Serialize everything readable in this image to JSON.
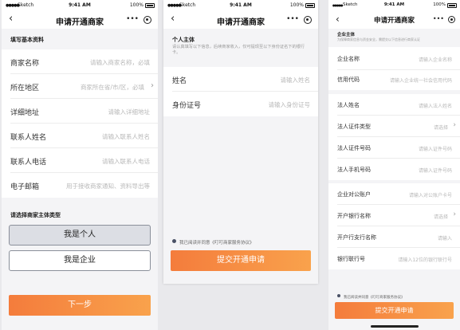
{
  "status": {
    "carrier": "Sketch",
    "time": "9:41 AM",
    "battery": "100%"
  },
  "nav": {
    "title": "申请开通商家",
    "more": "•••"
  },
  "screen1": {
    "section_title": "填写基本资料",
    "fields": [
      {
        "label": "商家名称",
        "placeholder": "请输入商家名称，必填"
      },
      {
        "label": "所在地区",
        "placeholder": "商家所在省/市/区，必填"
      },
      {
        "label": "详细地址",
        "placeholder": "请输入详细地址"
      },
      {
        "label": "联系人姓名",
        "placeholder": "请输入联系人姓名"
      },
      {
        "label": "联系人电话",
        "placeholder": "请输入联系人电话"
      },
      {
        "label": "电子邮箱",
        "placeholder": "用于接收商家通知、资料导出等"
      }
    ],
    "type_title": "请选择商家主体类型",
    "type_personal": "我是个人",
    "type_company": "我是企业",
    "next": "下一步"
  },
  "screen2": {
    "section_title": "个人主体",
    "section_desc": "请认真填写以下信息，后续商家收入，仅可提现至以下身份证名下的银行卡。",
    "fields": [
      {
        "label": "姓名",
        "placeholder": "请输入姓名"
      },
      {
        "label": "身份证号",
        "placeholder": "请输入身份证号"
      }
    ],
    "agree": "我已阅读并同意《叮叮商家服务协议》",
    "submit": "提交开通申请"
  },
  "screen3": {
    "section_title": "企业主体",
    "section_desc": "为保障商家信息与资金安全，需提交以下信息进行商家认证",
    "group1": [
      {
        "label": "企业名称",
        "placeholder": "请输入企业名称"
      },
      {
        "label": "信用代码",
        "placeholder": "请输入企业统一社会信用代码"
      }
    ],
    "group2": [
      {
        "label": "法人姓名",
        "placeholder": "请输入法人姓名"
      },
      {
        "label": "法人证件类型",
        "placeholder": "请选择"
      },
      {
        "label": "法人证件号码",
        "placeholder": "请输入证件号码"
      },
      {
        "label": "法人手机号码",
        "placeholder": "请输入证件号码"
      }
    ],
    "group3": [
      {
        "label": "企业对公账户",
        "placeholder": "请输入对公账户卡号"
      },
      {
        "label": "开户银行名称",
        "placeholder": "请选择"
      },
      {
        "label": "开户行支行名称",
        "placeholder": "请输入"
      },
      {
        "label": "银行联行号",
        "placeholder": "请输入12位的银行联行号"
      }
    ],
    "agree": "我已阅读并同意《叮叮商家服务协议》",
    "submit": "提交开通申请"
  }
}
